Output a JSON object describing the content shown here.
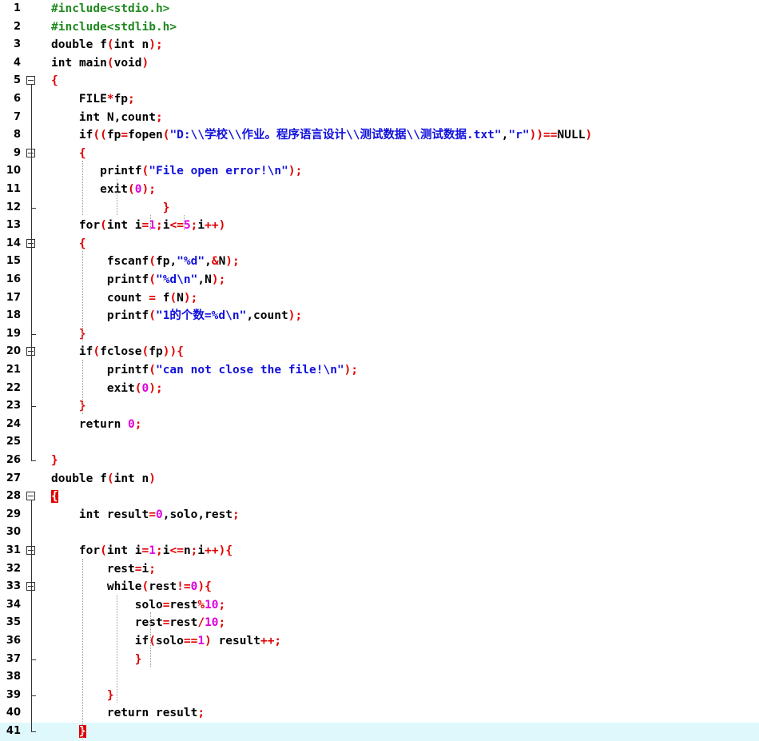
{
  "editor": {
    "line_numbers": [
      "1",
      "2",
      "3",
      "4",
      "5",
      "6",
      "7",
      "8",
      "9",
      "10",
      "11",
      "12",
      "13",
      "14",
      "15",
      "16",
      "17",
      "18",
      "19",
      "20",
      "21",
      "22",
      "23",
      "24",
      "25",
      "26",
      "27",
      "28",
      "29",
      "30",
      "31",
      "32",
      "33",
      "34",
      "35",
      "36",
      "37",
      "38",
      "39",
      "40",
      "41"
    ],
    "lines": [
      "#include<stdio.h>",
      "#include<stdlib.h>",
      "double f(int n);",
      "int main(void)",
      "{",
      "    FILE*fp;",
      "    int N,count;",
      "    if((fp=fopen(\"D:\\\\学校\\\\作业。程序语言设计\\\\测试数据\\\\测试数据.txt\",\"r\"))==NULL)",
      "    {",
      "       printf(\"File open error!\\n\");",
      "       exit(0);",
      "                }",
      "    for(int i=1;i<=5;i++)",
      "    {",
      "        fscanf(fp,\"%d\",&N);",
      "        printf(\"%d\\n\",N);",
      "        count = f(N);",
      "        printf(\"1的个数=%d\\n\",count);",
      "    }",
      "    if(fclose(fp)){",
      "        printf(\"can not close the file!\\n\");",
      "        exit(0);",
      "    }",
      "    return 0;",
      "",
      "}",
      "double f(int n)",
      "{",
      "    int result=0,solo,rest;",
      "",
      "    for(int i=1;i<=n;i++){",
      "        rest=i;",
      "        while(rest!=0){",
      "            solo=rest%10;",
      "            rest=rest/10;",
      "            if(solo==1) result++;",
      "            }",
      "",
      "        }",
      "        return result;",
      "    }"
    ],
    "current_line": "41",
    "colors": {
      "preprocessor": "#1f8a1f",
      "keyword": "#000000",
      "bracket_operator": "#e00000",
      "string": "#1010dd",
      "number": "#e000e0",
      "current_line_bg": "#dff8fb"
    }
  }
}
